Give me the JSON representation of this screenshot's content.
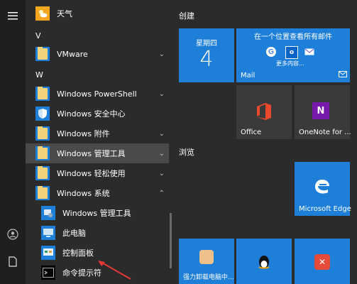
{
  "left_rail": {
    "menu_icon": "hamburger-icon",
    "user_icon": "user-icon",
    "docs_icon": "document-icon"
  },
  "app_list": {
    "rows": [
      {
        "type": "app",
        "label": "天气",
        "icon": "weather-icon"
      },
      {
        "type": "letter",
        "label": "V"
      },
      {
        "type": "folder",
        "label": "VMware",
        "chevron": "chevron-down"
      },
      {
        "type": "letter",
        "label": "W"
      },
      {
        "type": "folder",
        "label": "Windows PowerShell",
        "chevron": "chevron-down"
      },
      {
        "type": "app",
        "label": "Windows 安全中心",
        "icon": "shield-icon"
      },
      {
        "type": "folder",
        "label": "Windows 附件",
        "chevron": "chevron-down"
      },
      {
        "type": "folder",
        "label": "Windows 管理工具",
        "chevron": "chevron-down",
        "hover": true
      },
      {
        "type": "folder",
        "label": "Windows 轻松使用",
        "chevron": "chevron-down"
      },
      {
        "type": "folder",
        "label": "Windows 系统",
        "chevron": "chevron-up"
      },
      {
        "type": "app",
        "label": "Windows 管理工具",
        "icon": "admin-tools-icon"
      },
      {
        "type": "app",
        "label": "此电脑",
        "icon": "computer-icon"
      },
      {
        "type": "app",
        "label": "控制面板",
        "icon": "control-panel-icon"
      },
      {
        "type": "app",
        "label": "命令提示符",
        "icon": "cmd-icon"
      }
    ]
  },
  "tiles": {
    "group1": "创建",
    "group2": "浏览",
    "calendar": {
      "weekday": "星期四",
      "day": "4"
    },
    "mail": {
      "headline": "在一个位置查看所有邮件",
      "more": "更多内容...",
      "label": "Mail"
    },
    "office": {
      "label": "Office"
    },
    "onenote": {
      "label": "OneNote for ..."
    },
    "edge": {
      "label": "Microsoft Edge"
    },
    "uninstall": {
      "label": "强力卸载电脑中..."
    }
  },
  "colors": {
    "accent": "#1e7fd9",
    "background": "#2b2b2b",
    "rail": "#1f1f1f"
  }
}
